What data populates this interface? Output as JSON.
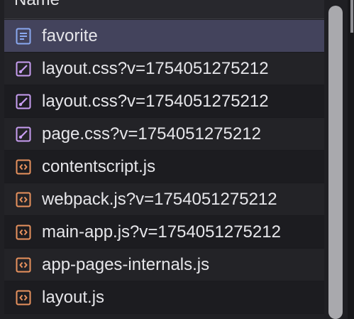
{
  "header": {
    "column_label": "Name"
  },
  "colors": {
    "document_icon": "#8aa8f0",
    "stylesheet_icon": "#c89ef2",
    "script_icon": "#e8925e",
    "selected_row": "#43435c"
  },
  "rows": [
    {
      "label": "favorite",
      "icon": "document-icon",
      "type": "document",
      "selected": true
    },
    {
      "label": "layout.css?v=1754051275212",
      "icon": "stylesheet-icon",
      "type": "stylesheet",
      "selected": false
    },
    {
      "label": "layout.css?v=1754051275212",
      "icon": "stylesheet-icon",
      "type": "stylesheet",
      "selected": false
    },
    {
      "label": "page.css?v=1754051275212",
      "icon": "stylesheet-icon",
      "type": "stylesheet",
      "selected": false
    },
    {
      "label": "contentscript.js",
      "icon": "script-icon",
      "type": "script",
      "selected": false
    },
    {
      "label": "webpack.js?v=1754051275212",
      "icon": "script-icon",
      "type": "script",
      "selected": false
    },
    {
      "label": "main-app.js?v=1754051275212",
      "icon": "script-icon",
      "type": "script",
      "selected": false
    },
    {
      "label": "app-pages-internals.js",
      "icon": "script-icon",
      "type": "script",
      "selected": false
    },
    {
      "label": "layout.js",
      "icon": "script-icon",
      "type": "script",
      "selected": false
    }
  ]
}
